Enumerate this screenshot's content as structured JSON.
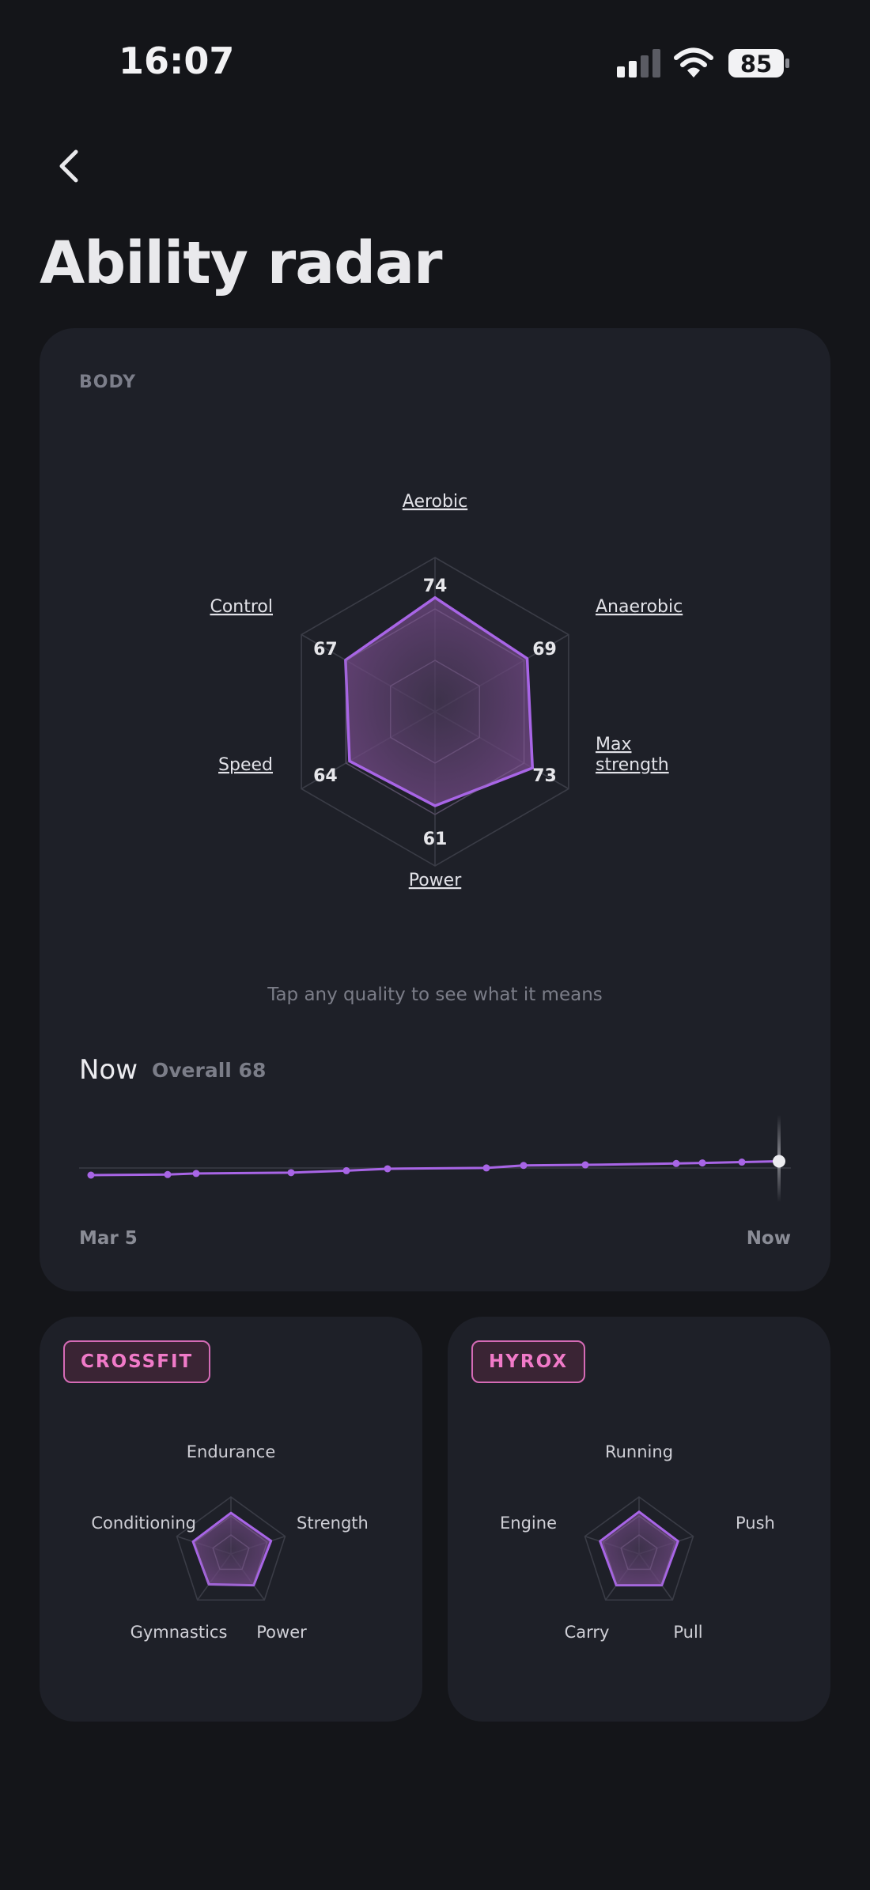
{
  "status": {
    "time": "16:07",
    "battery": "85"
  },
  "page": {
    "title": "Ability radar"
  },
  "body": {
    "section_label": "BODY",
    "hint": "Tap any quality to see what it means",
    "trend": {
      "now_label": "Now",
      "overall_label": "Overall 68",
      "start_label": "Mar 5",
      "end_label": "Now"
    }
  },
  "chart_data": [
    {
      "type": "radar",
      "axes": [
        "Aerobic",
        "Anaerobic",
        "Max strength",
        "Power",
        "Speed",
        "Control"
      ],
      "values": [
        74,
        69,
        73,
        61,
        64,
        67
      ],
      "max": 100
    },
    {
      "type": "line",
      "title": "",
      "x": [
        "Mar 5",
        "",
        "",
        "",
        "",
        "",
        "",
        "",
        "",
        "",
        "",
        "",
        "Now"
      ],
      "values": [
        63,
        63.2,
        63.6,
        63.9,
        64.6,
        65.3,
        65.6,
        66.5,
        66.7,
        67.2,
        67.4,
        67.7,
        68
      ],
      "x_labels": [
        "Mar 5",
        "Now"
      ]
    }
  ],
  "crossfit": {
    "tag": "CROSSFIT",
    "axes": [
      "Endurance",
      "Strength",
      "Power",
      "Gymnastics",
      "Conditioning"
    ],
    "values": [
      72,
      74,
      68,
      66,
      70
    ]
  },
  "hyrox": {
    "tag": "HYROX",
    "axes": [
      "Running",
      "Push",
      "Pull",
      "Carry",
      "Engine"
    ],
    "values": [
      74,
      72,
      68,
      68,
      72
    ]
  },
  "colors": {
    "accent": "#a865e6",
    "fill": "#7a4c8e",
    "tag": "#f07ac8",
    "bg": "#141519",
    "card": "#1e2028"
  }
}
